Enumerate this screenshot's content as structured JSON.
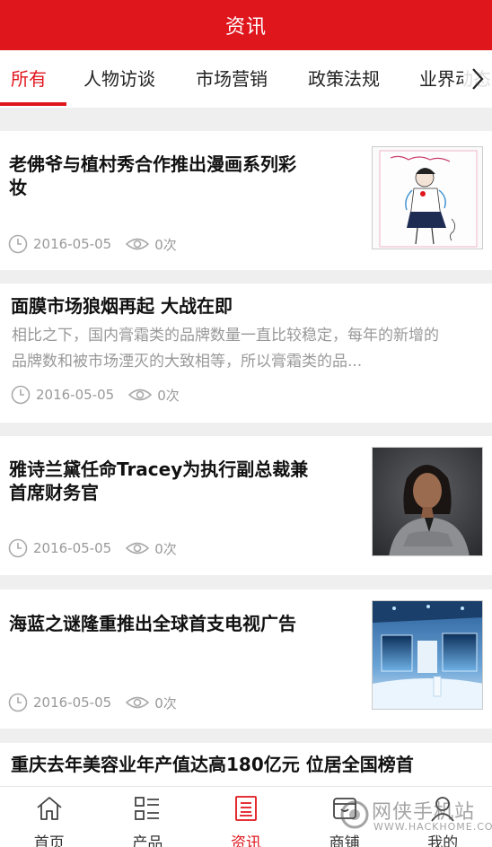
{
  "header": {
    "title": "资讯"
  },
  "tabs": [
    {
      "label": "所有"
    },
    {
      "label": "人物访谈"
    },
    {
      "label": "市场营销"
    },
    {
      "label": "政策法规"
    },
    {
      "label": "业界动态"
    }
  ],
  "articles": [
    {
      "title_line1": "老佛爷与植村秀合作推出漫画系列彩",
      "title_line2": "妆",
      "date": "2016-05-05",
      "views": "0次",
      "thumbnail": "illustration-sketch"
    },
    {
      "title_line1": "面膜市场狼烟再起 大战在即",
      "summary_line1": "相比之下，国内膏霜类的品牌数量一直比较稳定，每年的新增的",
      "summary_line2": "品牌数和被市场湮灭的大致相等，所以膏霜类的品...",
      "date": "2016-05-05",
      "views": "0次"
    },
    {
      "title_line1": "雅诗兰黛任命Tracey为执行副总裁兼",
      "title_line2": "首席财务官",
      "date": "2016-05-05",
      "views": "0次",
      "thumbnail": "portrait-photo"
    },
    {
      "title_line1": "海蓝之谜隆重推出全球首支电视广告",
      "date": "2016-05-05",
      "views": "0次",
      "thumbnail": "stage-event-photo"
    },
    {
      "title_line1": "重庆去年美容业年产值达高180亿元 位居全国榜首"
    }
  ],
  "bottom_nav": [
    {
      "label": "首页",
      "icon": "home-icon"
    },
    {
      "label": "产品",
      "icon": "grid-list-icon"
    },
    {
      "label": "资讯",
      "icon": "document-icon",
      "active": true
    },
    {
      "label": "商铺",
      "icon": "store-icon"
    },
    {
      "label": "我的",
      "icon": "user-icon"
    }
  ],
  "watermark": {
    "text": "网侠手机站",
    "url": "WWW.HACKHOME.COM"
  },
  "colors": {
    "primary": "#e0161d",
    "meta": "#999999",
    "background": "#efefef"
  }
}
